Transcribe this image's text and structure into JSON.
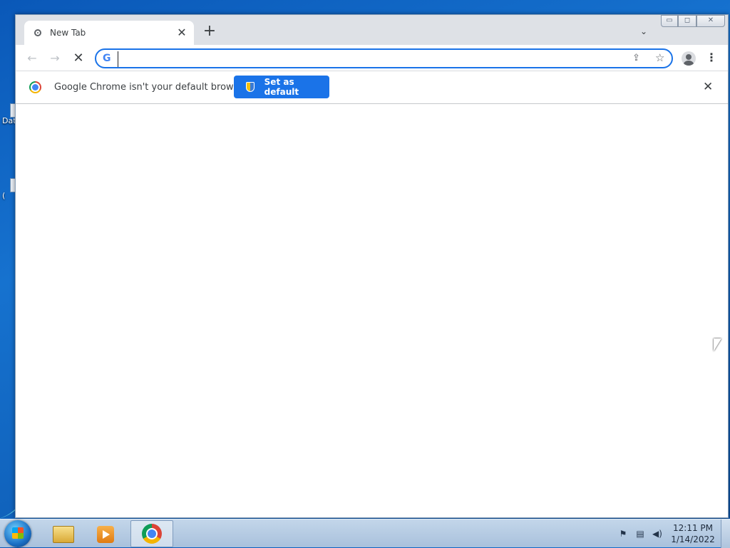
{
  "desktop": {
    "icons": [
      {
        "label": "Dat"
      },
      {
        "label": "("
      }
    ]
  },
  "browser": {
    "tab": {
      "title": "New Tab",
      "close_glyph": "✕"
    },
    "new_tab_glyph": "+",
    "tab_search_glyph": "⌄",
    "window_controls": {
      "minimize": "▭",
      "maximize": "◻",
      "close": "✕"
    },
    "toolbar": {
      "back_glyph": "←",
      "forward_glyph": "→",
      "stop_glyph": "✕",
      "omnibox_value": "",
      "omnibox_g": "G",
      "share_glyph": "⇪",
      "bookmark_glyph": "☆",
      "menu_glyph": "⋮"
    },
    "infobar": {
      "message": "Google Chrome isn't your default browser",
      "button_label": "Set as default",
      "close_glyph": "✕"
    }
  },
  "taskbar": {
    "clock_time": "12:11 PM",
    "clock_date": "1/14/2022",
    "tray": {
      "flag": "⚑",
      "network": "▤",
      "volume": "◀)"
    }
  },
  "colors": {
    "accent": "#1a73e8",
    "tab_strip": "#dee1e6",
    "desktop_blue": "#1672cf"
  }
}
